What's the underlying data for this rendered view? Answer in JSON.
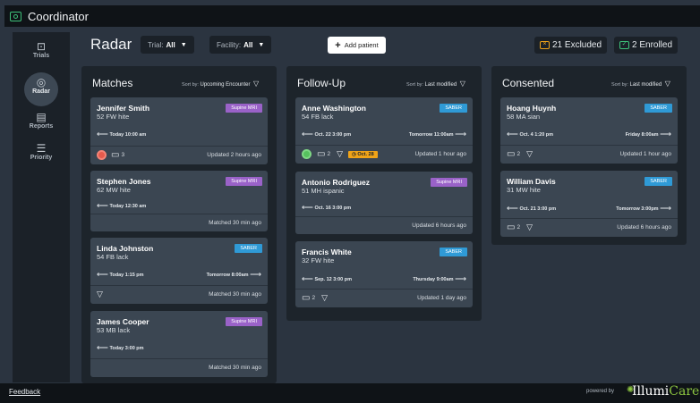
{
  "app": {
    "title": "Coordinator"
  },
  "sidebar": {
    "items": [
      {
        "label": "Trials",
        "icon": "trials-icon",
        "glyph": "⊡"
      },
      {
        "label": "Radar",
        "icon": "radar-icon",
        "glyph": "◎"
      },
      {
        "label": "Reports",
        "icon": "reports-icon",
        "glyph": "▤"
      },
      {
        "label": "Priority",
        "icon": "priority-icon",
        "glyph": "☰"
      }
    ],
    "active": "Radar"
  },
  "header": {
    "title": "Radar",
    "trial_filter": {
      "label": "Trial:",
      "value": "All"
    },
    "facility_filter": {
      "label": "Facility:",
      "value": "All"
    },
    "add_patient": "Add patient",
    "excluded": "21 Excluded",
    "enrolled": "2 Enrolled"
  },
  "columns": {
    "matches": {
      "title": "Matches",
      "sort_label": "Sort by:",
      "sort_value": "Upcoming Encounter",
      "cards": [
        {
          "name": "Jennifer Smith",
          "sub": "52 FW  hite",
          "tag": "Supine MRI",
          "left_time": "Today 10:00 am",
          "right_time": "",
          "comments": "3",
          "footer": "Updated 2 hours ago"
        },
        {
          "name": "Stephen Jones",
          "sub": "62 MW  hite",
          "tag": "Supine MRI",
          "left_time": "Today 12:30 am",
          "right_time": "",
          "footer": "Matched 30 min ago"
        },
        {
          "name": "Linda Johnston",
          "sub": "54 FB  lack",
          "tag": "SABER",
          "left_time": "Today 1:15 pm",
          "right_time": "Tomorrow 8:00am",
          "footer": "Matched 30 min ago"
        },
        {
          "name": "James Cooper",
          "sub": "53 MB  lack",
          "tag": "Supine MRI",
          "left_time": "Today 3:00 pm",
          "right_time": "",
          "footer": "Matched 30 min ago"
        }
      ]
    },
    "followup": {
      "title": "Follow-Up",
      "sort_label": "Sort by:",
      "sort_value": "Last modified",
      "cards": [
        {
          "name": "Anne Washington",
          "sub": "54 FB  lack",
          "tag": "SABER",
          "left_time": "Oct. 22 3:00 pm",
          "right_time": "Tomorrow 11:00am",
          "comments": "2",
          "date_badge": "Oct. 28",
          "footer": "Updated 1 hour ago"
        },
        {
          "name": "Antonio Rodriguez",
          "sub": "51 MH  ispanic",
          "tag": "Supine MRI",
          "left_time": "Oct. 16 3:00 pm",
          "right_time": "",
          "footer": "Updated 6 hours ago"
        },
        {
          "name": "Francis White",
          "sub": "32 FW  hite",
          "tag": "SABER",
          "left_time": "Sep. 12 3:00 pm",
          "right_time": "Thursday 9:00am",
          "comments": "2",
          "footer": "Updated 1 day ago"
        }
      ]
    },
    "consented": {
      "title": "Consented",
      "sort_label": "Sort by:",
      "sort_value": "Last modified",
      "cards": [
        {
          "name": "Hoang Huynh",
          "sub": "58 MA  sian",
          "tag": "SABER",
          "left_time": "Oct. 4 1:20 pm",
          "right_time": "Friday 8:00am",
          "comments": "2",
          "footer": "Updated 1 hour ago"
        },
        {
          "name": "William Davis",
          "sub": "31 MW  hite",
          "tag": "SABER",
          "left_time": "Oct. 21 3:00 pm",
          "right_time": "Tomorrow 3:00pm",
          "comments": "2",
          "footer": "Updated 6 hours ago"
        }
      ]
    }
  },
  "footer": {
    "feedback": "Feedback",
    "powered_by": "powered by",
    "brand_a": "Illumi",
    "brand_b": "Care"
  },
  "colors": {
    "accent_green": "#3ec27a",
    "tag_mri": "#9a62c8",
    "tag_saber": "#2f9ad6",
    "excluded": "#f0a318",
    "badge": "#f0a318"
  }
}
